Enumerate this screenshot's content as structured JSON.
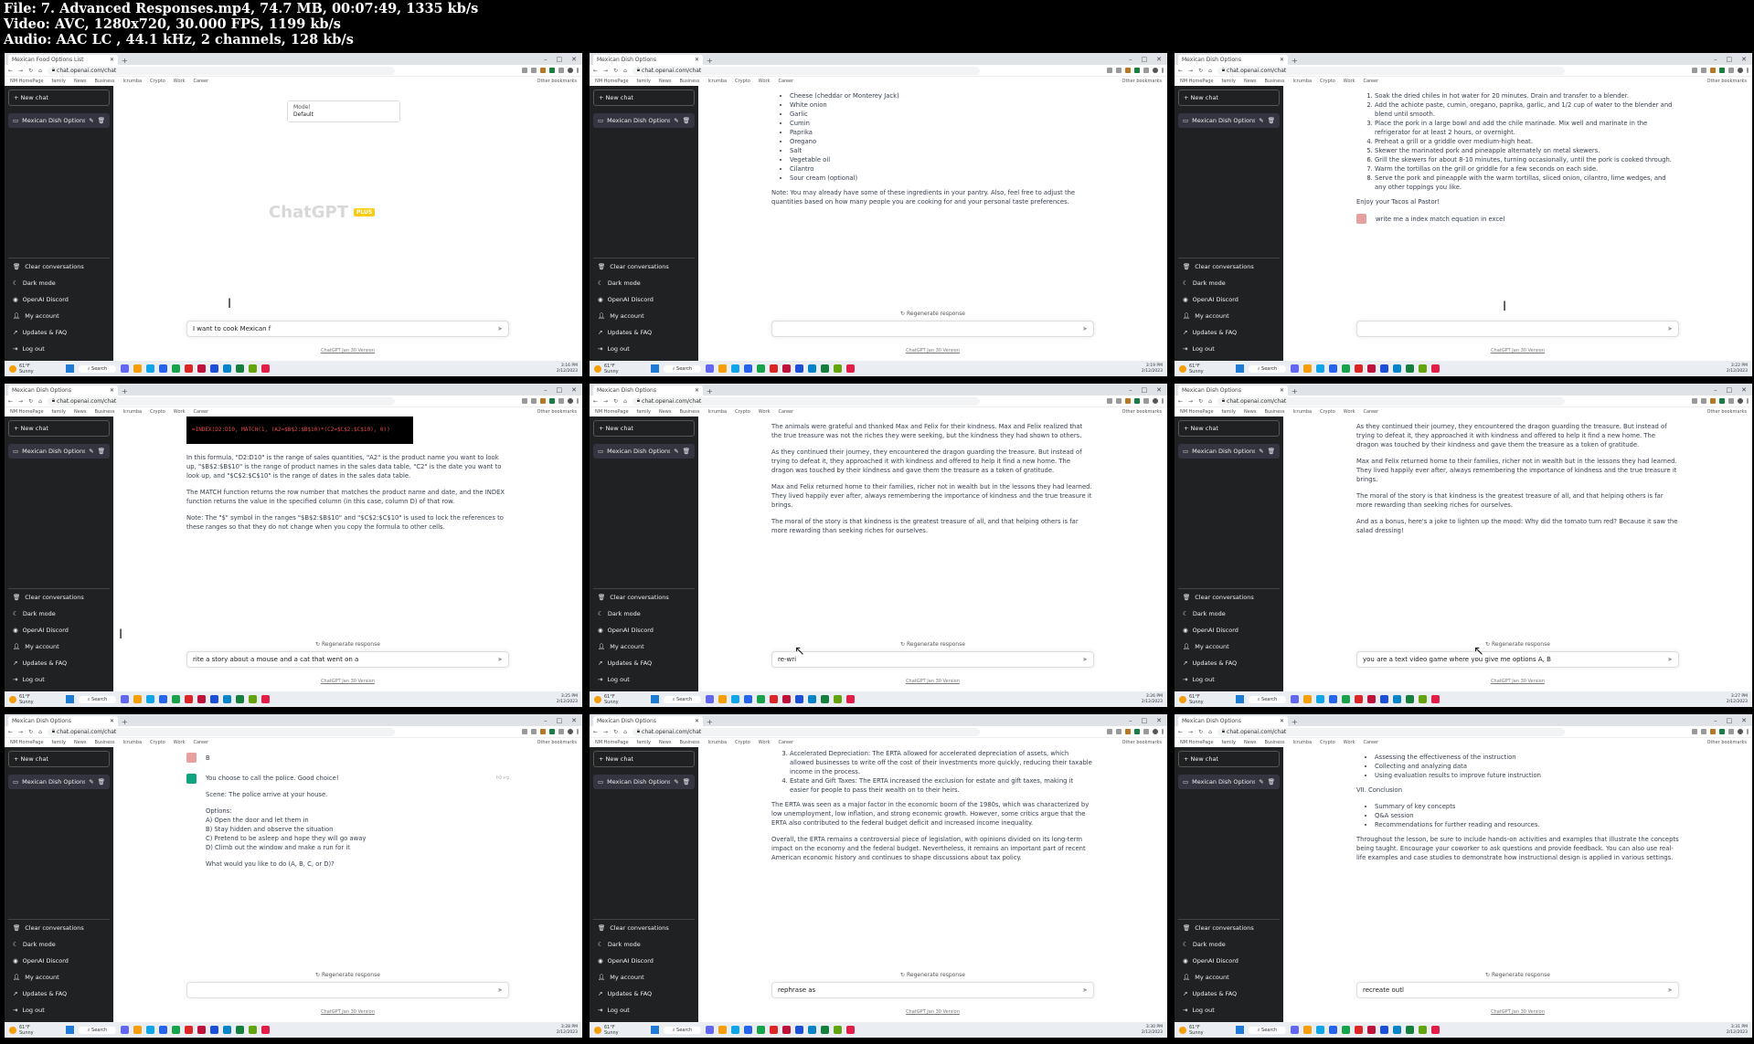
{
  "header": {
    "line1": "File: 7. Advanced Responses.mp4, 74.7 MB, 00:07:49, 1335 kb/s",
    "line2": "Video: AVC, 1280x720, 30.000 FPS, 1199 kb/s",
    "line3": "Audio: AAC LC , 44.1 kHz, 2 channels, 128 kb/s"
  },
  "browser": {
    "url": "chat.openai.com/chat",
    "new_tab": "+",
    "bookmarks": [
      "NM HomePage",
      "family",
      "News",
      "Business",
      "Icrumba",
      "Crypto",
      "Work",
      "Career"
    ],
    "other_bookmarks": "Other bookmarks"
  },
  "sidebar": {
    "new_chat": "+ New chat",
    "conversation": "Mexican Dish Options",
    "items": [
      "Clear conversations",
      "Dark mode",
      "OpenAI Discord",
      "My account",
      "Updates & FAQ",
      "Log out"
    ]
  },
  "common": {
    "regenerate": "Regenerate response",
    "footer": "ChatGPT Jan 30 Version"
  },
  "taskbar": {
    "temp": "61°F",
    "cond": "Sunny",
    "search": "Search",
    "date": "2/12/2023"
  },
  "frames": [
    {
      "tab": "Mexican Food Options List",
      "input": "I want to cook Mexican f",
      "model_label": "Model",
      "model_value": "Default",
      "logo": "ChatGPT",
      "plus": "PLUS",
      "time": "3:16 PM"
    },
    {
      "tab": "Mexican Dish Options",
      "items": [
        "Cheese (cheddar or Monterey Jack)",
        "White onion",
        "Garlic",
        "Cumin",
        "Paprika",
        "Oregano",
        "Salt",
        "Vegetable oil",
        "Cilantro",
        "Sour cream (optional)"
      ],
      "note": "Note: You may already have some of these ingredients in your pantry. Also, feel free to adjust the quantities based on how many people you are cooking for and your personal taste preferences.",
      "input": "",
      "time": "3:19 PM"
    },
    {
      "tab": "Mexican Dish Options",
      "steps": [
        "Soak the dried chiles in hot water for 20 minutes. Drain and transfer to a blender.",
        "Add the achiote paste, cumin, oregano, paprika, garlic, and 1/2 cup of water to the blender and blend until smooth.",
        "Place the pork in a large bowl and add the chile marinade. Mix well and marinate in the refrigerator for at least 2 hours, or overnight.",
        "Preheat a grill or a griddle over medium-high heat.",
        "Skewer the marinated pork and pineapple alternately on metal skewers.",
        "Grill the skewers for about 8-10 minutes, turning occasionally, until the pork is cooked through.",
        "Warm the tortillas on the grill or griddle for a few seconds on each side.",
        "Serve the pork and pineapple with the warm tortillas, sliced onion, cilantro, lime wedges, and any other toppings you like."
      ],
      "closing": "Enjoy your Tacos al Pastor!",
      "user_msg": "write me a index match equation in excel",
      "input": "",
      "time": "3:22 PM"
    },
    {
      "tab": "Mexican Dish Options",
      "code": "=INDEX(D2:D10, MATCH(1, (A2=$B$2:$B$10)*(C2=$C$2:$C$10), 0))",
      "p1": "In this formula, \"D2:D10\" is the range of sales quantities, \"A2\" is the product name you want to look up, \"$B$2:$B$10\" is the range of product names in the sales data table, \"C2\" is the date you want to look up, and \"$C$2:$C$10\" is the range of dates in the sales data table.",
      "p2": "The MATCH function returns the row number that matches the product name and date, and the INDEX function returns the value in the specified column (in this case, column D) of that row.",
      "p3": "Note: The \"$\" symbol in the ranges \"$B$2:$B$10\" and \"$C$2:$C$10\" is used to lock the references to these ranges so that they do not change when you copy the formula to other cells.",
      "input": "rite a story about a mouse and a cat that went on a",
      "time": "3:25 PM"
    },
    {
      "tab": "Mexican Dish Options",
      "p1": "The animals were grateful and thanked Max and Felix for their kindness. Max and Felix realized that the true treasure was not the riches they were seeking, but the kindness they had shown to others.",
      "p2": "As they continued their journey, they encountered the dragon guarding the treasure. But instead of trying to defeat it, they approached it with kindness and offered to help it find a new home. The dragon was touched by their kindness and gave them the treasure as a token of gratitude.",
      "p3": "Max and Felix returned home to their families, richer not in wealth but in the lessons they had learned. They lived happily ever after, always remembering the importance of kindness and the true treasure it brings.",
      "p4": "The moral of the story is that kindness is the greatest treasure of all, and that helping others is far more rewarding than seeking riches for ourselves.",
      "input": "re-wri",
      "time": "3:26 PM"
    },
    {
      "tab": "Mexican Dish Options",
      "p1": "As they continued their journey, they encountered the dragon guarding the treasure. But instead of trying to defeat it, they approached it with kindness and offered to help it find a new home. The dragon was touched by their kindness and gave them the treasure as a token of gratitude.",
      "p2": "Max and Felix returned home to their families, richer not in wealth but in the lessons they had learned. They lived happily ever after, always remembering the importance of kindness and the true treasure it brings.",
      "p3": "The moral of the story is that kindness is the greatest treasure of all, and that helping others is far more rewarding than seeking riches for ourselves.",
      "p4": "And as a bonus, here's a joke to lighten up the mood: Why did the tomato turn red? Because it saw the salad dressing!",
      "input": "you are a text video game where you give me options A, B",
      "time": "3:27 PM"
    },
    {
      "tab": "Mexican Dish Options",
      "user_msg": "B",
      "p1": "You choose to call the police. Good choice!",
      "p2": "Scene: The police arrive at your house.",
      "options_label": "Options:",
      "options": [
        "A) Open the door and let them in",
        "B) Stay hidden and observe the situation",
        "C) Pretend to be asleep and hope they will go away",
        "D) Climb out the window and make a run for it"
      ],
      "question": "What would you like to do (A, B, C, or D)?",
      "input": "",
      "time": "3:28 PM"
    },
    {
      "tab": "Mexican Dish Options",
      "items": [
        "Accelerated Depreciation: The ERTA allowed for accelerated depreciation of assets, which allowed businesses to write off the cost of their investments more quickly, reducing their taxable income in the process.",
        "Estate and Gift Taxes: The ERTA increased the exclusion for estate and gift taxes, making it easier for people to pass their wealth on to their heirs."
      ],
      "p1": "The ERTA was seen as a major factor in the economic boom of the 1980s, which was characterized by low unemployment, low inflation, and strong economic growth. However, some critics argue that the ERTA also contributed to the federal budget deficit and increased income inequality.",
      "p2": "Overall, the ERTA remains a controversial piece of legislation, with opinions divided on its long-term impact on the economy and the federal budget. Nevertheless, it remains an important part of recent American economic history and continues to shape discussions about tax policy.",
      "input": "rephrase as",
      "time": "3:30 PM"
    },
    {
      "tab": "Mexican Dish Options",
      "items": [
        "Assessing the effectiveness of the instruction",
        "Collecting and analyzing data",
        "Using evaluation results to improve future instruction"
      ],
      "heading": "VII. Conclusion",
      "items2": [
        "Summary of key concepts",
        "Q&A session",
        "Recommendations for further reading and resources."
      ],
      "p1": "Throughout the lesson, be sure to include hands-on activities and examples that illustrate the concepts being taught. Encourage your coworker to ask questions and provide feedback. You can also use real-life examples and case studies to demonstrate how instructional design is applied in various settings.",
      "input": "recreate outl",
      "time": "3:31 PM"
    }
  ]
}
